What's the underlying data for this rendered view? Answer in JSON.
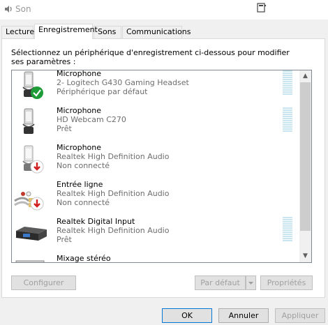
{
  "window": {
    "title": "Son"
  },
  "tabs": [
    {
      "label": "Lecture"
    },
    {
      "label": "Enregistrement"
    },
    {
      "label": "Sons"
    },
    {
      "label": "Communications"
    }
  ],
  "instruction": "Sélectionnez un périphérique d'enregistrement ci-dessous pour modifier ses paramètres :",
  "devices": [
    {
      "name": "Microphone",
      "line2": "2- Logitech G430 Gaming Headset",
      "line3": "Périphérique par défaut",
      "icon": "headset-mic-icon",
      "status": "default-check"
    },
    {
      "name": "Microphone",
      "line2": "HD Webcam C270",
      "line3": "Prêt",
      "icon": "microphone-icon",
      "status": "ready"
    },
    {
      "name": "Microphone",
      "line2": "Realtek High Definition Audio",
      "line3": "Non connecté",
      "icon": "microphone-icon",
      "status": "disconnected"
    },
    {
      "name": "Entrée ligne",
      "line2": "Realtek High Definition Audio",
      "line3": "Non connecté",
      "icon": "line-in-cable-icon",
      "status": "disconnected"
    },
    {
      "name": "Realtek Digital Input",
      "line2": "Realtek High Definition Audio",
      "line3": "Prêt",
      "icon": "digital-input-icon",
      "status": "ready"
    },
    {
      "name": "Mixage stéréo",
      "line2": "",
      "line3": "",
      "icon": "stereo-mix-icon",
      "status": "partial"
    }
  ],
  "buttons": {
    "configure": "Configurer",
    "set_default": "Par défaut",
    "properties": "Propriétés",
    "ok": "OK",
    "cancel": "Annuler",
    "apply": "Appliquer"
  },
  "colors": {
    "selection_border": "#0078d7",
    "check_green": "#1e9c37",
    "disconnected_red": "#d01e1e",
    "level_meter": "#c9e6f0"
  }
}
